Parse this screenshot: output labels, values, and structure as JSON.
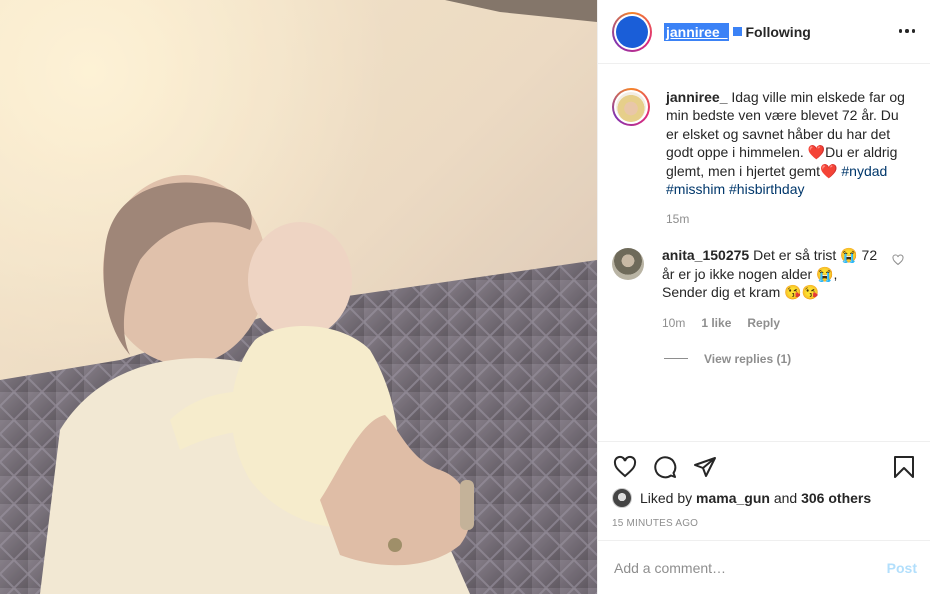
{
  "post": {
    "photo_description_icon": "photo-of-man-kissing-baby"
  },
  "header": {
    "username": "janniree_",
    "separator": "•",
    "follow_status": "Following",
    "more_icon": "more-dots-icon"
  },
  "caption": {
    "username": "janniree_",
    "text_1": " Idag ville min elskede far og min bedste ven være blevet 72 år. Du er elsket og savnet håber du har det godt oppe i himmelen. ",
    "heart_1": "❤️",
    "text_2": "Du er aldrig glemt, men i hjertet gemt",
    "heart_2": "❤️",
    "tags": [
      "#nydad",
      "#misshim",
      "#hisbirthday"
    ],
    "time": "15m"
  },
  "comment": {
    "username": "anita_150275",
    "text_1": " Det er så trist ",
    "emoji_1": "😭",
    "text_2": " 72 år er jo ikke nogen alder ",
    "emoji_2": "😭",
    "text_3": ", Sender dig et kram ",
    "emoji_3": "😘😘",
    "time": "10m",
    "likes": "1 like",
    "reply": "Reply",
    "view_replies": "View replies (1)"
  },
  "actions": {
    "liked_by_prefix": "Liked by ",
    "liked_by_user": "mama_gun",
    "liked_by_and": " and ",
    "others": "306 others",
    "posted_ago": "15 MINUTES AGO"
  },
  "add_comment": {
    "placeholder": "Add a comment…",
    "post_label": "Post"
  },
  "colors": {
    "link": "#00376b",
    "muted": "#8e8e8e",
    "post_disabled": "#b2dffc",
    "selection": "#3b82f6"
  }
}
